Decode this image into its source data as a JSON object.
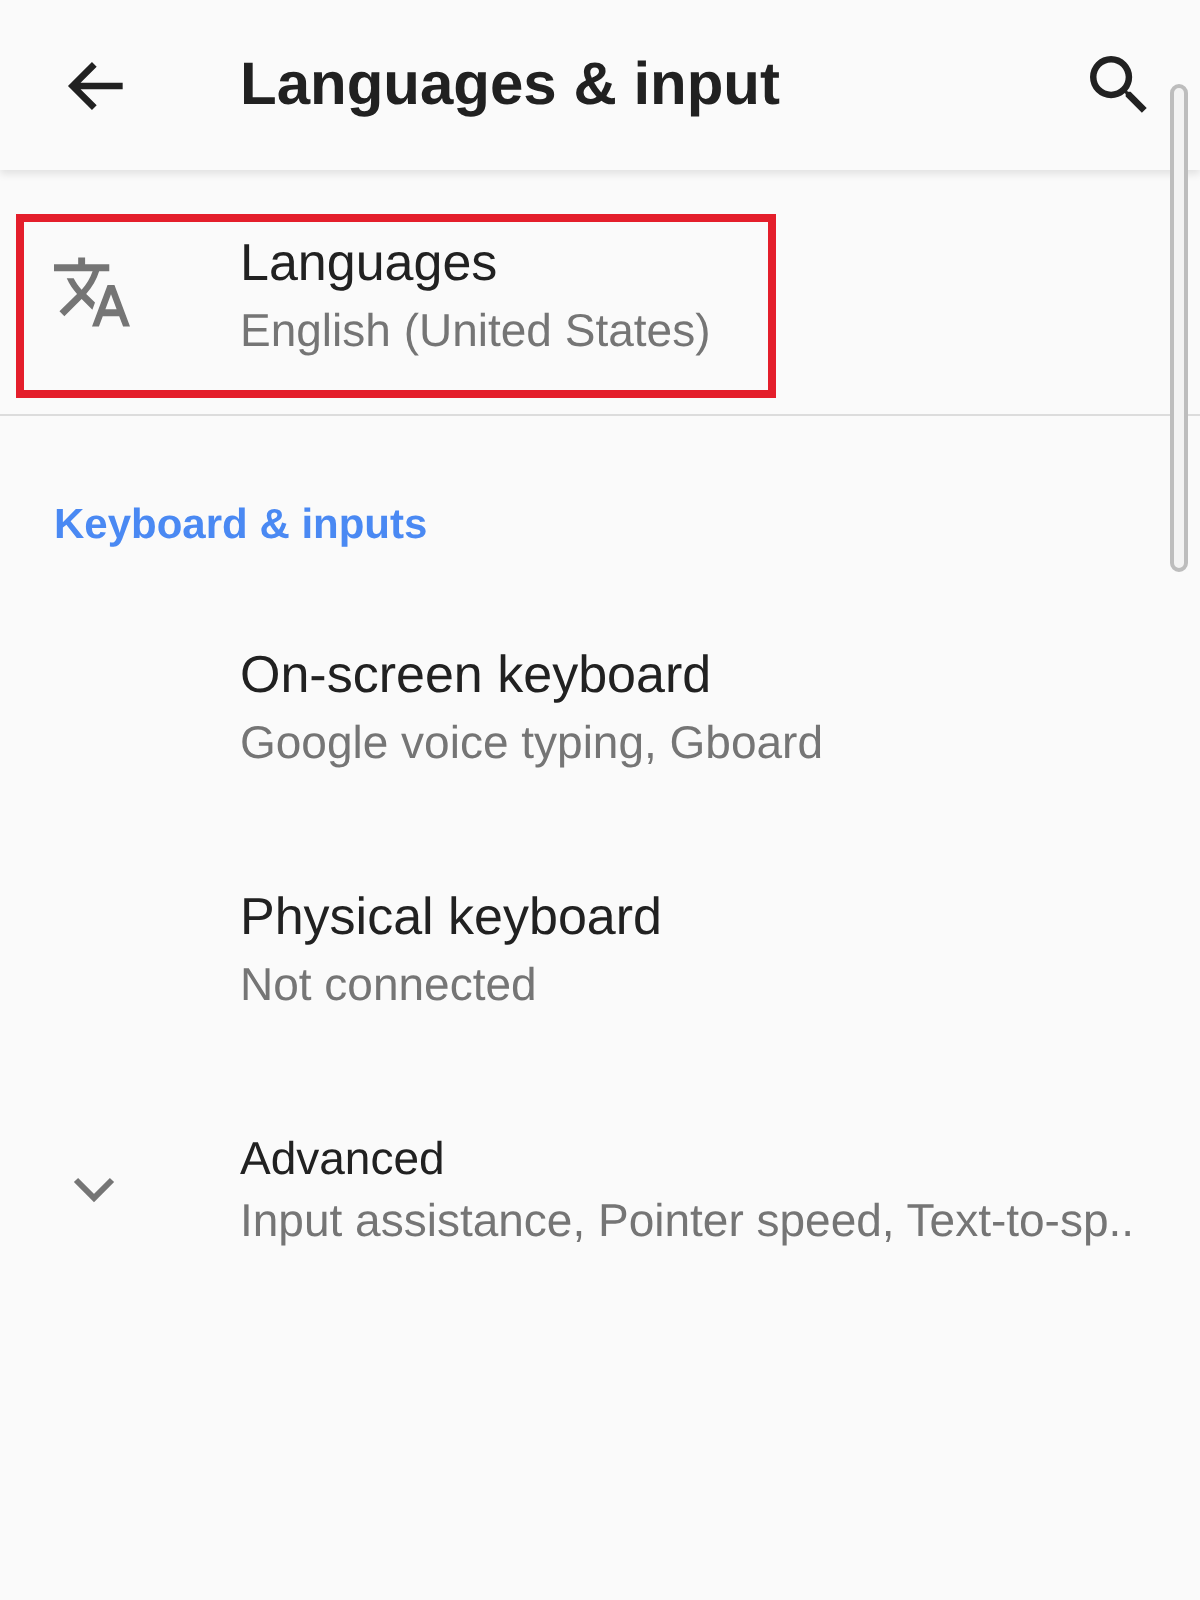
{
  "app_bar": {
    "title": "Languages & input"
  },
  "top_items": [
    {
      "title": "Languages",
      "summary": "English (United States)",
      "highlighted": true
    }
  ],
  "sections": [
    {
      "header": "Keyboard & inputs",
      "items": [
        {
          "title": "On-screen keyboard",
          "summary": "Google voice typing, Gboard",
          "highlighted": false
        },
        {
          "title": "Physical keyboard",
          "summary": "Not connected",
          "highlighted": false
        }
      ]
    }
  ],
  "advanced": {
    "title": "Advanced",
    "summary": "Input assistance, Pointer speed, Text-to-sp..",
    "expanded": false
  }
}
